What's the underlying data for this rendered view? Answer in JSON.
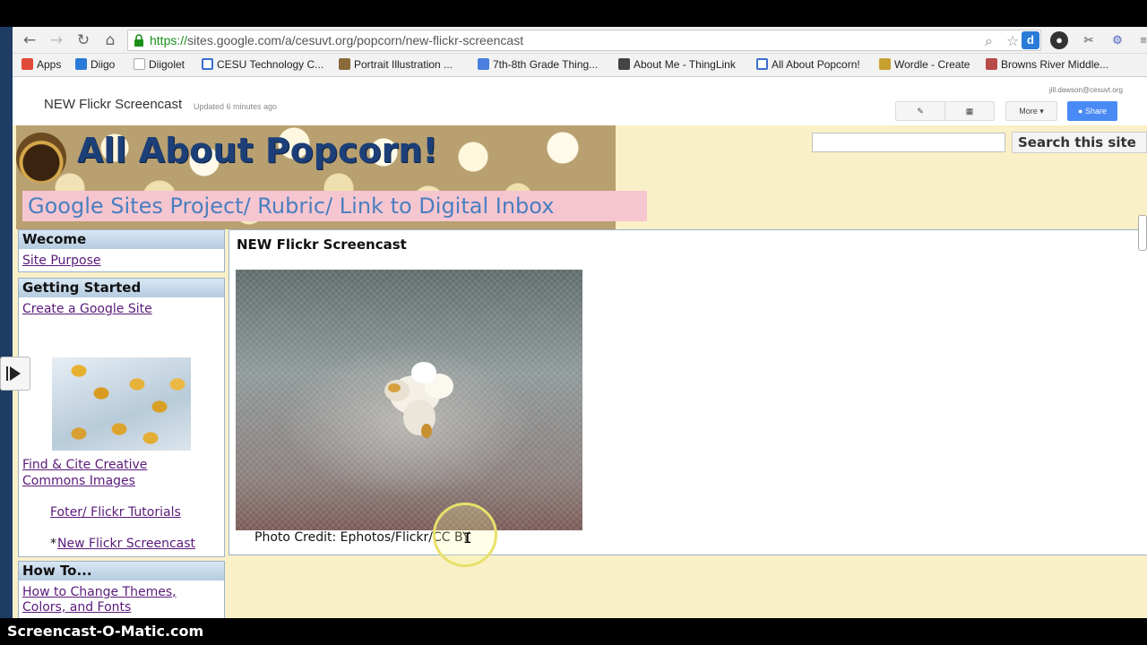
{
  "browser": {
    "url_scheme": "https://",
    "url_rest": "sites.google.com/a/cesuvt.org/popcorn/new-flickr-screencast",
    "bookmarks": [
      {
        "label": "Apps",
        "color": "#e04a3a"
      },
      {
        "label": "Diigo",
        "color": "#2a7ad8"
      },
      {
        "label": "Diigolet",
        "color": "#cccccc"
      },
      {
        "label": "CESU Technology C...",
        "color": "#3b6fd0"
      },
      {
        "label": "Portrait Illustration ...",
        "color": "#8a6a3a"
      },
      {
        "label": "7th-8th Grade Thing...",
        "color": "#4a7fe0"
      },
      {
        "label": "About Me - ThingLink",
        "color": "#444444"
      },
      {
        "label": "All About Popcorn!",
        "color": "#3b6fd0"
      },
      {
        "label": "Wordle - Create",
        "color": "#c8a030"
      },
      {
        "label": "Browns River Middle...",
        "color": "#b84a4a"
      }
    ]
  },
  "site": {
    "page_title": "NEW Flickr Screencast",
    "updated": "Updated 6 minutes ago",
    "user_email": "jill.dawson@cesuvt.org",
    "more_label": "More",
    "share_label": "Share"
  },
  "header": {
    "title": "All About Popcorn!",
    "subtitle": "Google Sites Project/ Rubric/ Link to Digital Inbox",
    "search_button": "Search this site",
    "search_value": ""
  },
  "sidebar": {
    "welcome": {
      "heading": "Wecome",
      "links": [
        "Site Purpose"
      ]
    },
    "getting_started": {
      "heading": "Getting Started",
      "link_create": "Create a Google Site",
      "link_find_line1": "Find & Cite Creative",
      "link_find_line2": "Commons Images",
      "link_tutorials": "Foter/ Flickr Tutorials",
      "current_marker": "*",
      "link_current": "New Flickr Screencast"
    },
    "how_to": {
      "heading": "How To...",
      "link_line1": "How to Change Themes,",
      "link_line2": "Colors, and Fonts"
    }
  },
  "main": {
    "title": "NEW Flickr Screencast",
    "photo_credit": "Photo Credit:  Ephotos/Flickr/CC BY"
  },
  "watermark": "Screencast-O-Matic.com",
  "icons": {
    "back": "arrow-left-icon",
    "forward": "arrow-right-icon",
    "reload": "reload-icon",
    "home": "home-icon"
  }
}
